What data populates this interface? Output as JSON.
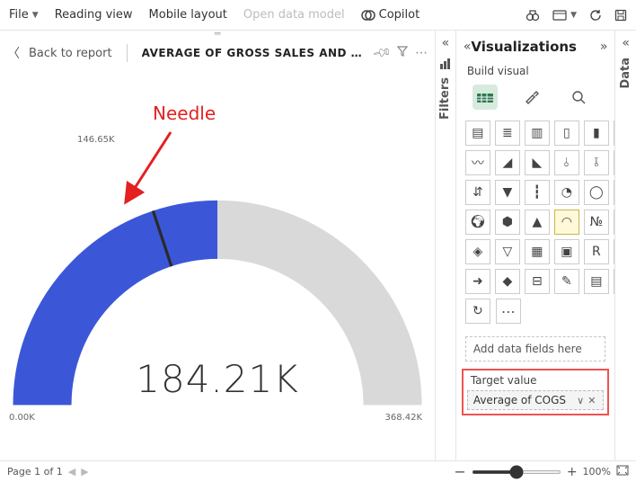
{
  "toolbar": {
    "file": "File",
    "reading_view": "Reading view",
    "mobile_layout": "Mobile layout",
    "open_data_model": "Open data model",
    "copilot": "Copilot"
  },
  "canvas": {
    "back": "Back to report",
    "title": "AVERAGE OF GROSS SALES AND AVERAG..."
  },
  "gauge": {
    "value": "184.21K",
    "min": "0.00K",
    "max": "368.42K",
    "needle_label": "146.65K",
    "fill_fraction": 0.5,
    "needle_fraction": 0.398
  },
  "annotation": {
    "label": "Needle"
  },
  "filters": {
    "title": "Filters"
  },
  "viz_pane": {
    "title": "Visualizations",
    "subtitle": "Build visual",
    "add_data": "Add data fields here",
    "target_label": "Target value",
    "target_value": "Average of COGS",
    "icons": [
      "bar-stacked",
      "bar-clustered",
      "bar-100",
      "col-stacked",
      "col-clustered",
      "col-100",
      "line",
      "area",
      "area-stacked",
      "line-col",
      "line-col2",
      "ribbon",
      "waterfall",
      "funnel",
      "scatter",
      "pie",
      "donut",
      "treemap",
      "map",
      "filled-map",
      "azure-map",
      "gauge",
      "card-num",
      "card-kpi",
      "kpi",
      "slicer",
      "table",
      "matrix",
      "r",
      "py",
      "arrow",
      "powerapps",
      "bullet",
      "narrative",
      "paginated",
      "sparkle"
    ],
    "selected_icon_index": 21
  },
  "data_rail": {
    "title": "Data"
  },
  "footer": {
    "page": "Page 1 of 1",
    "zoom": "100%"
  },
  "chart_data": {
    "type": "gauge",
    "title": "AVERAGE OF GROSS SALES AND AVERAGE OF COGS",
    "value": 184210,
    "min": 0,
    "max": 368420,
    "target": 146650,
    "value_display": "184.21K",
    "target_display": "146.65K",
    "min_display": "0.00K",
    "max_display": "368.42K"
  }
}
